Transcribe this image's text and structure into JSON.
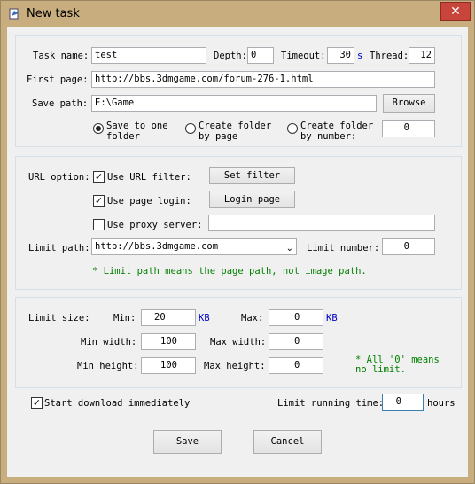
{
  "window": {
    "title": "New task",
    "close_label": "✕"
  },
  "task": {
    "name_label": "Task name:",
    "name_value": "test",
    "depth_label": "Depth:",
    "depth_value": "0",
    "timeout_label": "Timeout:",
    "timeout_value": "30",
    "timeout_unit": "s",
    "thread_label": "Thread:",
    "thread_value": "12",
    "first_page_label": "First page:",
    "first_page_value": "http://bbs.3dmgame.com/forum-276-1.html",
    "save_path_label": "Save path:",
    "save_path_value": "E:\\Game",
    "browse_label": "Browse",
    "radio_options": [
      {
        "line1": "Save to one",
        "line2": "folder",
        "selected": true
      },
      {
        "line1": "Create folder",
        "line2": "by page",
        "selected": false
      },
      {
        "line1": "Create folder",
        "line2": "by number:",
        "selected": false
      }
    ],
    "folder_number_value": "0"
  },
  "url": {
    "option_label": "URL option:",
    "use_filter_label": "Use URL filter:",
    "use_filter_checked": true,
    "set_filter_label": "Set filter",
    "use_login_label": "Use page login:",
    "use_login_checked": true,
    "login_page_label": "Login page",
    "use_proxy_label": "Use proxy server:",
    "use_proxy_checked": false,
    "proxy_value": "",
    "limit_path_label": "Limit path:",
    "limit_path_value": "http://bbs.3dmgame.com",
    "limit_number_label": "Limit number:",
    "limit_number_value": "0",
    "note": "* Limit path means the page path, not image path."
  },
  "size": {
    "limit_size_label": "Limit size:",
    "min_label": "Min:",
    "min_value": "20",
    "min_unit": "KB",
    "max_label": "Max:",
    "max_value": "0",
    "max_unit": "KB",
    "min_width_label": "Min width:",
    "min_width_value": "100",
    "max_width_label": "Max width:",
    "max_width_value": "0",
    "min_height_label": "Min height:",
    "min_height_value": "100",
    "max_height_label": "Max height:",
    "max_height_value": "0",
    "note_line1": "* All '0' means",
    "note_line2": "no limit."
  },
  "footer": {
    "start_label": "Start download immediately",
    "start_checked": true,
    "limit_time_label": "Limit running time:",
    "limit_time_value": "0",
    "hours_label": "hours",
    "save_label": "Save",
    "cancel_label": "Cancel"
  }
}
